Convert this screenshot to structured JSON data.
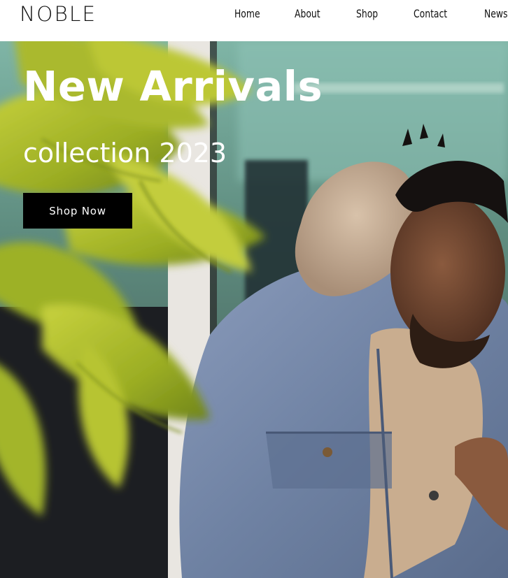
{
  "brand": {
    "logo": "NOBLE"
  },
  "nav": {
    "items": [
      {
        "label": "Home"
      },
      {
        "label": "About"
      },
      {
        "label": "Shop"
      },
      {
        "label": "Contact"
      },
      {
        "label": "News"
      }
    ]
  },
  "hero": {
    "title": "New Arrivals",
    "subtitle": "collection 2023",
    "cta_label": "Shop Now"
  },
  "colors": {
    "header_bg": "#ffffff",
    "text_dark": "#111111",
    "hero_text": "#ffffff",
    "button_bg": "#000000",
    "button_text": "#ffffff",
    "leaf_green": "#b5c230",
    "denim_blue": "#7688a6"
  }
}
